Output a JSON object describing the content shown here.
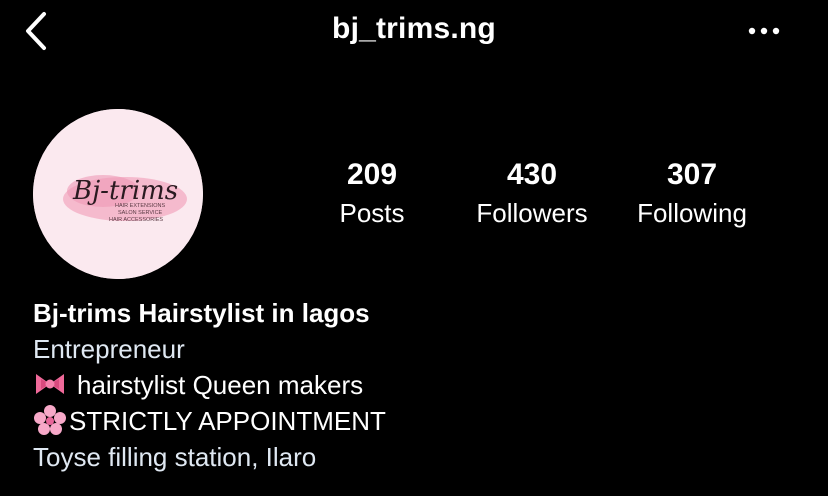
{
  "header": {
    "username": "bj_trims.ng"
  },
  "avatar": {
    "logo_text": "Bj-trims",
    "logo_lines": [
      "HAIR EXTENSIONS",
      "SALON SERVICE",
      "HAIR ACCESSORIES"
    ]
  },
  "stats": [
    {
      "count": "209",
      "label": "Posts"
    },
    {
      "count": "430",
      "label": "Followers"
    },
    {
      "count": "307",
      "label": "Following"
    }
  ],
  "bio": {
    "name": "Bj-trims Hairstylist in lagos",
    "category": "Entrepreneur",
    "line1": "hairstylist Queen makers",
    "line2": "STRICTLY APPOINTMENT",
    "address": "Toyse filling station, Ilaro"
  },
  "icons": {
    "back": "chevron-left-icon",
    "more": "more-horizontal-icon",
    "bow": "ribbon-emoji",
    "flower": "cherry-blossom-emoji"
  },
  "colors": {
    "background": "#000000",
    "text": "#ffffff",
    "link": "#dfe8f2",
    "logo_pink": "#f3a9c1"
  }
}
